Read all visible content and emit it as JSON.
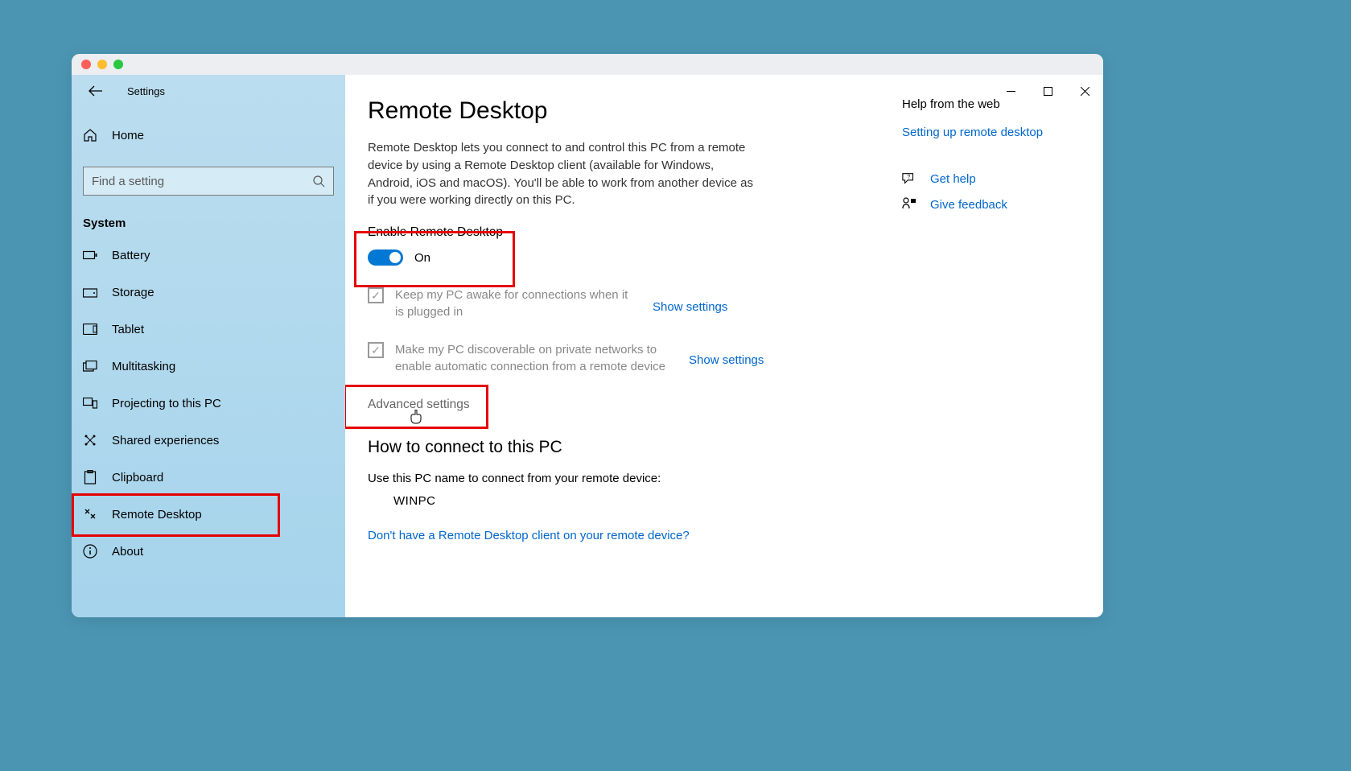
{
  "app_title": "Settings",
  "sidebar": {
    "home": "Home",
    "search_placeholder": "Find a setting",
    "section": "System",
    "items": [
      "Battery",
      "Storage",
      "Tablet",
      "Multitasking",
      "Projecting to this PC",
      "Shared experiences",
      "Clipboard",
      "Remote Desktop",
      "About"
    ]
  },
  "page": {
    "title": "Remote Desktop",
    "description": "Remote Desktop lets you connect to and control this PC from a remote device by using a Remote Desktop client (available for Windows, Android, iOS and macOS). You'll be able to work from another device as if you were working directly on this PC.",
    "toggle_title": "Enable Remote Desktop",
    "toggle_state": "On",
    "check1": "Keep my PC awake for connections when it is plugged in",
    "check2": "Make my PC discoverable on private networks to enable automatic connection from a remote device",
    "show_settings": "Show settings",
    "advanced": "Advanced settings",
    "how_title": "How to connect to this PC",
    "how_text": "Use this PC name to connect from your remote device:",
    "pc_name": "WINPC",
    "dl_link": "Don't have a Remote Desktop client on your remote device?"
  },
  "help": {
    "title": "Help from the web",
    "link1": "Setting up remote desktop",
    "get_help": "Get help",
    "feedback": "Give feedback"
  }
}
